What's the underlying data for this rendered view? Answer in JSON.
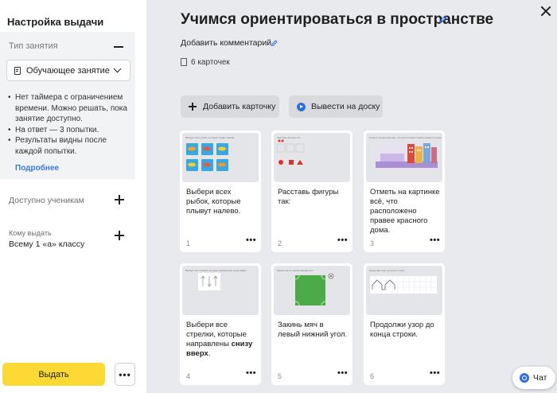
{
  "sidebar": {
    "title": "Настройка выдачи",
    "type_heading": "Тип занятия",
    "type_value": "Обучающее занятие",
    "bullets": [
      "Нет таймера с ограничением времени. Можно решать, пока занятие доступно.",
      "На ответ — 3 попытки.",
      "Результаты видны после каждой попытки."
    ],
    "more_link": "Подробнее",
    "available_label": "Доступно ученикам",
    "assign_to_label": "Кому выдать",
    "assign_to_value": "Всему 1 «а» классу",
    "issue_button": "Выдать",
    "more_button": "•••"
  },
  "main": {
    "title": "Учимся ориентироваться в пространстве",
    "add_comment": "Добавить комментарий",
    "cards_count": "6 карточек",
    "add_card_button": "Добавить карточку",
    "show_on_board_button": "Вывести на доску",
    "cards": [
      {
        "number": "1",
        "task": "Выбери всех рыбок, которые плывут налево.",
        "thumb_caption": "Выбери всех рыбок, которые плывут налево"
      },
      {
        "number": "2",
        "task": "Расставь фигуры так:",
        "thumb_caption": "Расставь фигуры так"
      },
      {
        "number": "3",
        "task": "Отметь на картинке всё, что расположено правее красного дома.",
        "thumb_caption": "Отметь на картинке всё, что расположено правее красного дома"
      },
      {
        "number": "4",
        "task_plain": "Выбери все стрелки, которые направлены ",
        "task_bold": "снизу вверх",
        "task_end": ".",
        "thumb_caption": "Выбери все стрелки, которые направлены снизу вверх"
      },
      {
        "number": "5",
        "task": "Закинь мяч в левый нижний угол.",
        "thumb_caption": "Закинь мяч в левый нижний угол"
      },
      {
        "number": "6",
        "task": "Продолжи узор до конца строки.",
        "thumb_caption": "Продолжи узор до конца строки"
      }
    ],
    "card_menu": "•••"
  },
  "chat_button": "Чат",
  "colors": {
    "accent_yellow": "#fdd935",
    "link_blue": "#3c7ad6",
    "icon_blue": "#2f6fe3",
    "background": "#e9eaed"
  },
  "icons": {
    "close": "close-icon",
    "edit": "pencil-icon",
    "add": "plus-icon",
    "collapse": "minus-icon",
    "dropdown": "chevron-down-icon",
    "cards": "cards-icon",
    "board": "play-icon",
    "chat": "chat-icon"
  }
}
